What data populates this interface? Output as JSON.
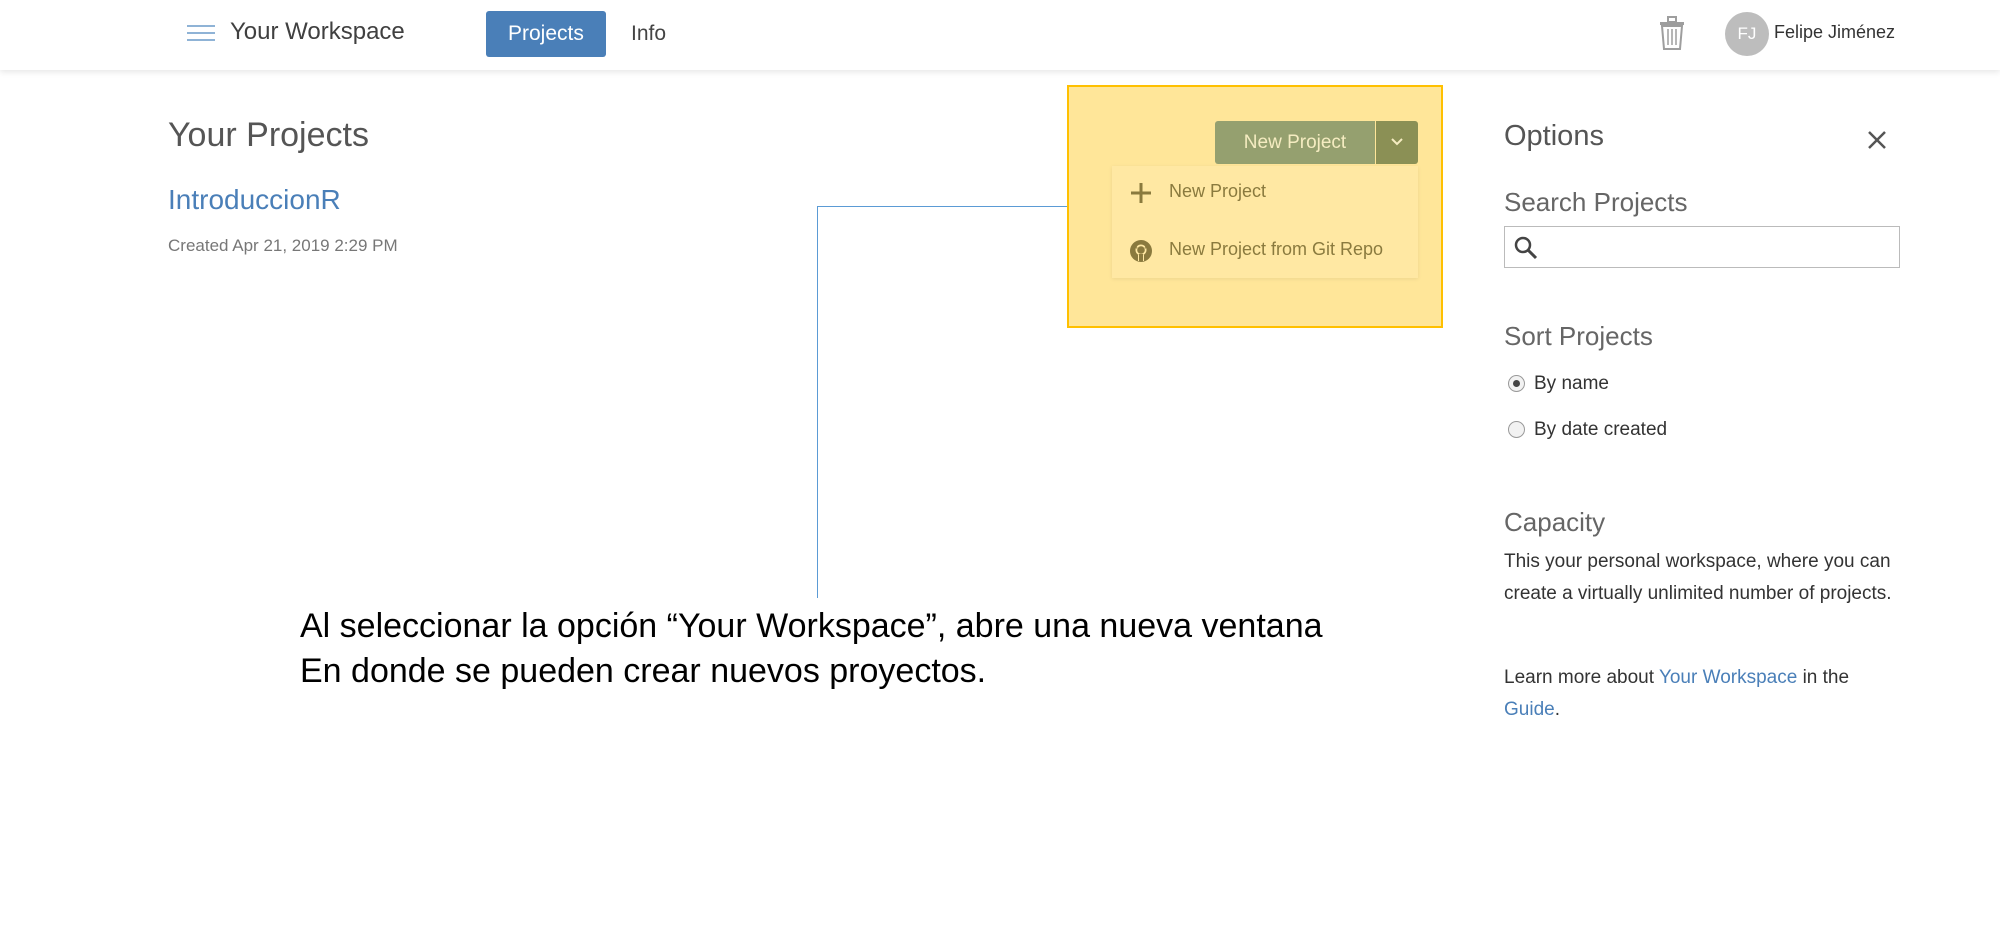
{
  "header": {
    "workspace_title": "Your Workspace",
    "tabs": [
      {
        "label": "Projects",
        "active": true
      },
      {
        "label": "Info",
        "active": false
      }
    ],
    "user": {
      "initials": "FJ",
      "name": "Felipe Jiménez"
    },
    "icons": [
      "hamburger-icon",
      "trash-icon"
    ]
  },
  "main": {
    "title": "Your Projects",
    "projects": [
      {
        "name": "IntroduccionR",
        "created": "Created Apr 21, 2019 2:29 PM"
      }
    ]
  },
  "new_project_menu": {
    "button_label": "New Project",
    "items": [
      {
        "label": "New Project",
        "icon": "plus-icon"
      },
      {
        "label": "New Project from Git Repo",
        "icon": "github-icon"
      }
    ],
    "highlight_color": "#ffe699",
    "highlight_border": "#ffc000"
  },
  "annotation": {
    "line1": "Al seleccionar la opción “Your Workspace”, abre una nueva ventana",
    "line2": "En donde se pueden crear nuevos proyectos."
  },
  "options": {
    "title": "Options",
    "search": {
      "heading": "Search Projects",
      "placeholder": "",
      "value": ""
    },
    "sort": {
      "heading": "Sort Projects",
      "options": [
        {
          "label": "By name",
          "selected": true
        },
        {
          "label": "By date created",
          "selected": false
        }
      ]
    },
    "capacity": {
      "heading": "Capacity",
      "text": "This your personal workspace, where you can create a virtually unlimited number of projects.",
      "learn_prefix": "Learn more about ",
      "learn_link": "Your Workspace",
      "learn_middle": " in the ",
      "guide_link": "Guide",
      "learn_suffix": "."
    }
  },
  "colors": {
    "accent": "#4a7fb8",
    "connector": "#5b9bd5"
  }
}
